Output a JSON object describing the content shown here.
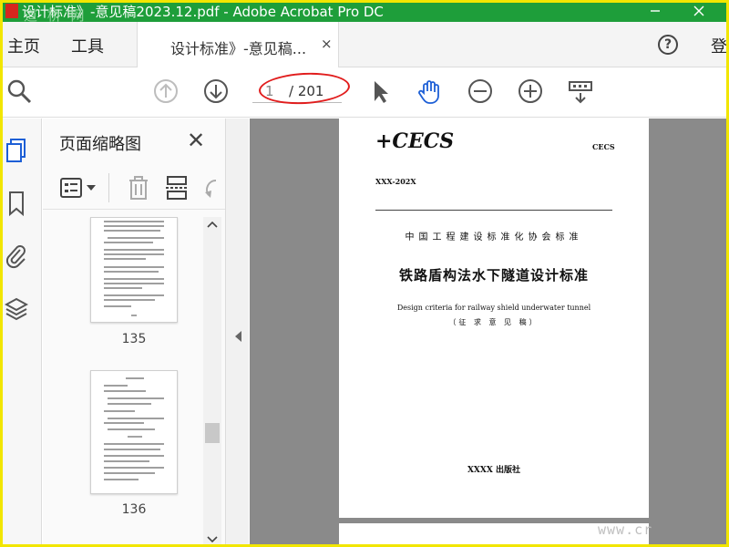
{
  "titlebar": {
    "title": "设计标准》-意见稿2023.12.pdf - Adobe Acrobat Pro DC",
    "watermark": "道 桥 网",
    "minimize_icon": "minimize-icon",
    "close_icon": "close-icon"
  },
  "menu": {
    "home": "主页",
    "tools": "工具",
    "tab_label": "设计标准》-意见稿...",
    "tab_close": "×",
    "help": "?",
    "login": "登"
  },
  "toolbar": {
    "icons": [
      "search-icon",
      "page-up-icon",
      "page-down-icon",
      "select-cursor-icon",
      "hand-tool-icon",
      "zoom-out-icon",
      "zoom-in-icon",
      "page-display-icon"
    ],
    "current_page": "1",
    "total_pages": "/ 201"
  },
  "rail": {
    "icons": [
      "page-thumbnails-icon",
      "bookmark-icon",
      "attachment-icon",
      "layers-icon"
    ]
  },
  "panel": {
    "title": "页面缩略图",
    "close": "✕",
    "tools": [
      "thumbnail-options-icon",
      "delete-icon",
      "insert-page-icon",
      "rotate-icon"
    ],
    "thumbnails": [
      {
        "page": "135"
      },
      {
        "page": "136"
      }
    ]
  },
  "document": {
    "logo": "+CECS",
    "logo_right": "CECS",
    "code": "XXX-202X",
    "association": "中国工程建设标准化协会标准",
    "cn_title": "铁路盾构法水下隧道设计标准",
    "en_title": "Design criteria for railway shield underwater tunnel",
    "draft": "（征 求 意 见 稿）",
    "publisher": "XXXX 出版社"
  },
  "watermark_url": "www.cr",
  "colors": {
    "titlebar": "#1e9e3a",
    "frame": "#f2e600",
    "accent_blue": "#1d5fd6",
    "annotation_red": "#e11d1d"
  }
}
